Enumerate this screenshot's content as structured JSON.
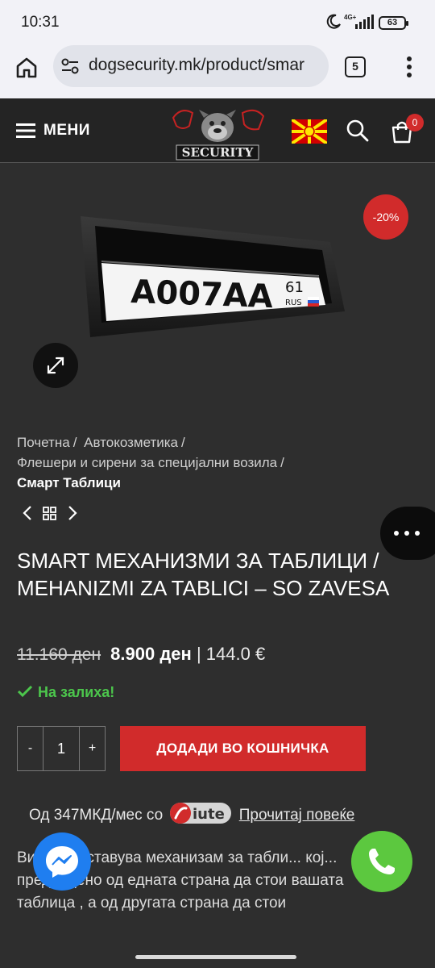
{
  "status_bar": {
    "time": "10:31",
    "network": "4G+",
    "battery": "63"
  },
  "browser": {
    "url": "dogsecurity.mk/product/smar",
    "tab_count": "5"
  },
  "site_header": {
    "menu_label": "МЕНИ",
    "logo_text": "SECURITY",
    "cart_count": "0"
  },
  "product_image": {
    "plate_text": "A007AA",
    "plate_region": "61",
    "plate_country": "RUS",
    "sale_badge": "-20%"
  },
  "breadcrumb": {
    "items": [
      "Почетна",
      "Автокозметика",
      "Флешери и сирени за специјални возила"
    ],
    "current": "Смарт Таблици"
  },
  "product": {
    "title": "SMART МЕХАНИЗМИ ЗА ТАБЛИЦИ / MEHANIZMI ZA TABLICI – SO ZAVESA",
    "old_price": "11.160 ден",
    "new_price": "8.900 ден",
    "eur_price": "| 144.0 €",
    "stock": "На залиха!",
    "quantity": "1",
    "qty_minus": "-",
    "qty_plus": "+",
    "add_to_cart": "ДОДАДИ ВО КОШНИЧКА"
  },
  "iute": {
    "prefix": "Од 347МКД/мес со",
    "brand": "iute",
    "link": "Прочитај повеќе"
  },
  "description": "Ви... представува механизам за табли... кој... предвидено од едната страна да стои вашата таблица , а од другата страна да стои",
  "colors": {
    "accent": "#d12b2b",
    "stock_green": "#4cc64c",
    "background": "#2e2e2e",
    "header": "#242424",
    "messenger": "#1f7ef0",
    "phone": "#5cc83f"
  }
}
